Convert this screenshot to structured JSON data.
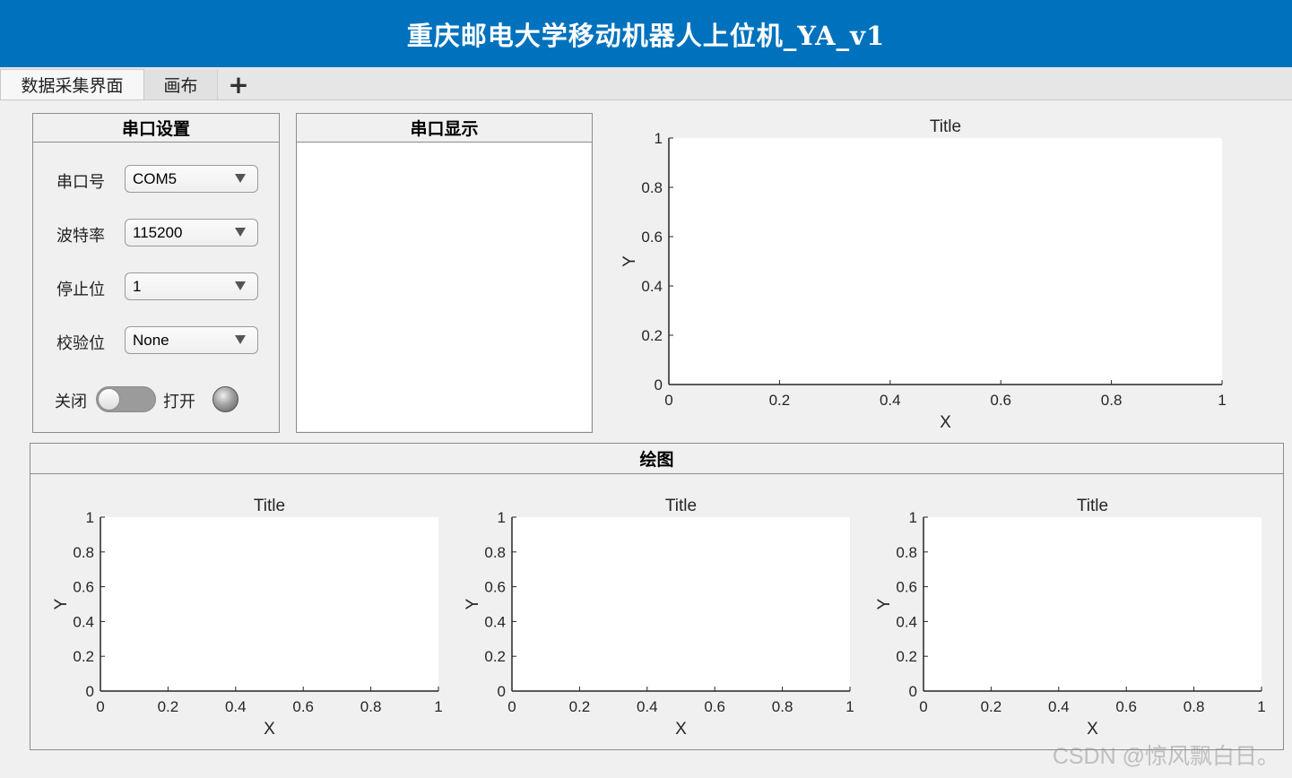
{
  "app": {
    "title": "重庆邮电大学移动机器人上位机_YA_v1"
  },
  "tabs": [
    {
      "label": "数据采集界面",
      "active": true
    },
    {
      "label": "画布",
      "active": false
    }
  ],
  "add_tab_label": "+",
  "serial_settings": {
    "title": "串口设置",
    "fields": [
      {
        "label": "串口号",
        "value": "COM5"
      },
      {
        "label": "波特率",
        "value": "115200"
      },
      {
        "label": "停止位",
        "value": "1"
      },
      {
        "label": "校验位",
        "value": "None"
      }
    ],
    "toggle": {
      "off_label": "关闭",
      "on_label": "打开",
      "state": "off"
    },
    "lamp_color": "#8c8c8c"
  },
  "serial_display": {
    "title": "串口显示",
    "content": ""
  },
  "plot_panel": {
    "title": "绘图"
  },
  "watermark": "CSDN @惊风飘白日。",
  "colors": {
    "accent": "#0072bd",
    "background": "#f0f0f0",
    "panel_border": "#8c8c8c"
  },
  "chart_data": [
    {
      "type": "line",
      "title": "Title",
      "xlabel": "X",
      "ylabel": "Y",
      "xlim": [
        0,
        1
      ],
      "ylim": [
        0,
        1
      ],
      "x_ticks": [
        "0",
        "0.2",
        "0.4",
        "0.6",
        "0.8",
        "1"
      ],
      "y_ticks": [
        "0",
        "0.2",
        "0.4",
        "0.6",
        "0.8",
        "1"
      ],
      "series": []
    },
    {
      "type": "line",
      "title": "Title",
      "xlabel": "X",
      "ylabel": "Y",
      "xlim": [
        0,
        1
      ],
      "ylim": [
        0,
        1
      ],
      "x_ticks": [
        "0",
        "0.2",
        "0.4",
        "0.6",
        "0.8",
        "1"
      ],
      "y_ticks": [
        "0",
        "0.2",
        "0.4",
        "0.6",
        "0.8",
        "1"
      ],
      "series": []
    },
    {
      "type": "line",
      "title": "Title",
      "xlabel": "X",
      "ylabel": "Y",
      "xlim": [
        0,
        1
      ],
      "ylim": [
        0,
        1
      ],
      "x_ticks": [
        "0",
        "0.2",
        "0.4",
        "0.6",
        "0.8",
        "1"
      ],
      "y_ticks": [
        "0",
        "0.2",
        "0.4",
        "0.6",
        "0.8",
        "1"
      ],
      "series": []
    },
    {
      "type": "line",
      "title": "Title",
      "xlabel": "X",
      "ylabel": "Y",
      "xlim": [
        0,
        1
      ],
      "ylim": [
        0,
        1
      ],
      "x_ticks": [
        "0",
        "0.2",
        "0.4",
        "0.6",
        "0.8",
        "1"
      ],
      "y_ticks": [
        "0",
        "0.2",
        "0.4",
        "0.6",
        "0.8",
        "1"
      ],
      "series": []
    }
  ]
}
